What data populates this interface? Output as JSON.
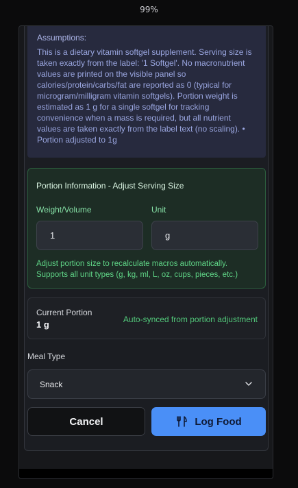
{
  "browser": {
    "zoom_level": "99%"
  },
  "assumptions": {
    "heading": "Assumptions:",
    "text": "This is a dietary vitamin softgel supplement. Serving size is taken exactly from the label: '1 Softgel'. No macronutrient values are printed on the visible panel so calories/protein/carbs/fat are reported as 0 (typical for microgram/milligram vitamin softgels). Portion weight is estimated as 1 g for a single softgel for tracking convenience when a mass is required, but all nutrient values are taken exactly from the label text (no scaling). • Portion adjusted to 1g"
  },
  "portion": {
    "title": "Portion Information - Adjust Serving Size",
    "weight_label": "Weight/Volume",
    "unit_label": "Unit",
    "weight_value": "1",
    "unit_value": "g",
    "help": "Adjust portion size to recalculate macros automatically. Supports all unit types (g, kg, ml, L, oz, cups, pieces, etc.)"
  },
  "current": {
    "label": "Current Portion",
    "value": "1 g",
    "sync_note": "Auto-synced from portion adjustment"
  },
  "meal": {
    "label": "Meal Type",
    "selected": "Snack"
  },
  "actions": {
    "cancel": "Cancel",
    "log": "Log Food"
  },
  "icons": {
    "dropdown": "chevron-down-icon",
    "log": "utensils-icon"
  },
  "colors": {
    "accent": "#4a8ff7",
    "success": "#52c87a",
    "info_bg": "#272a3e",
    "portion_bg": "#1d2d25"
  }
}
